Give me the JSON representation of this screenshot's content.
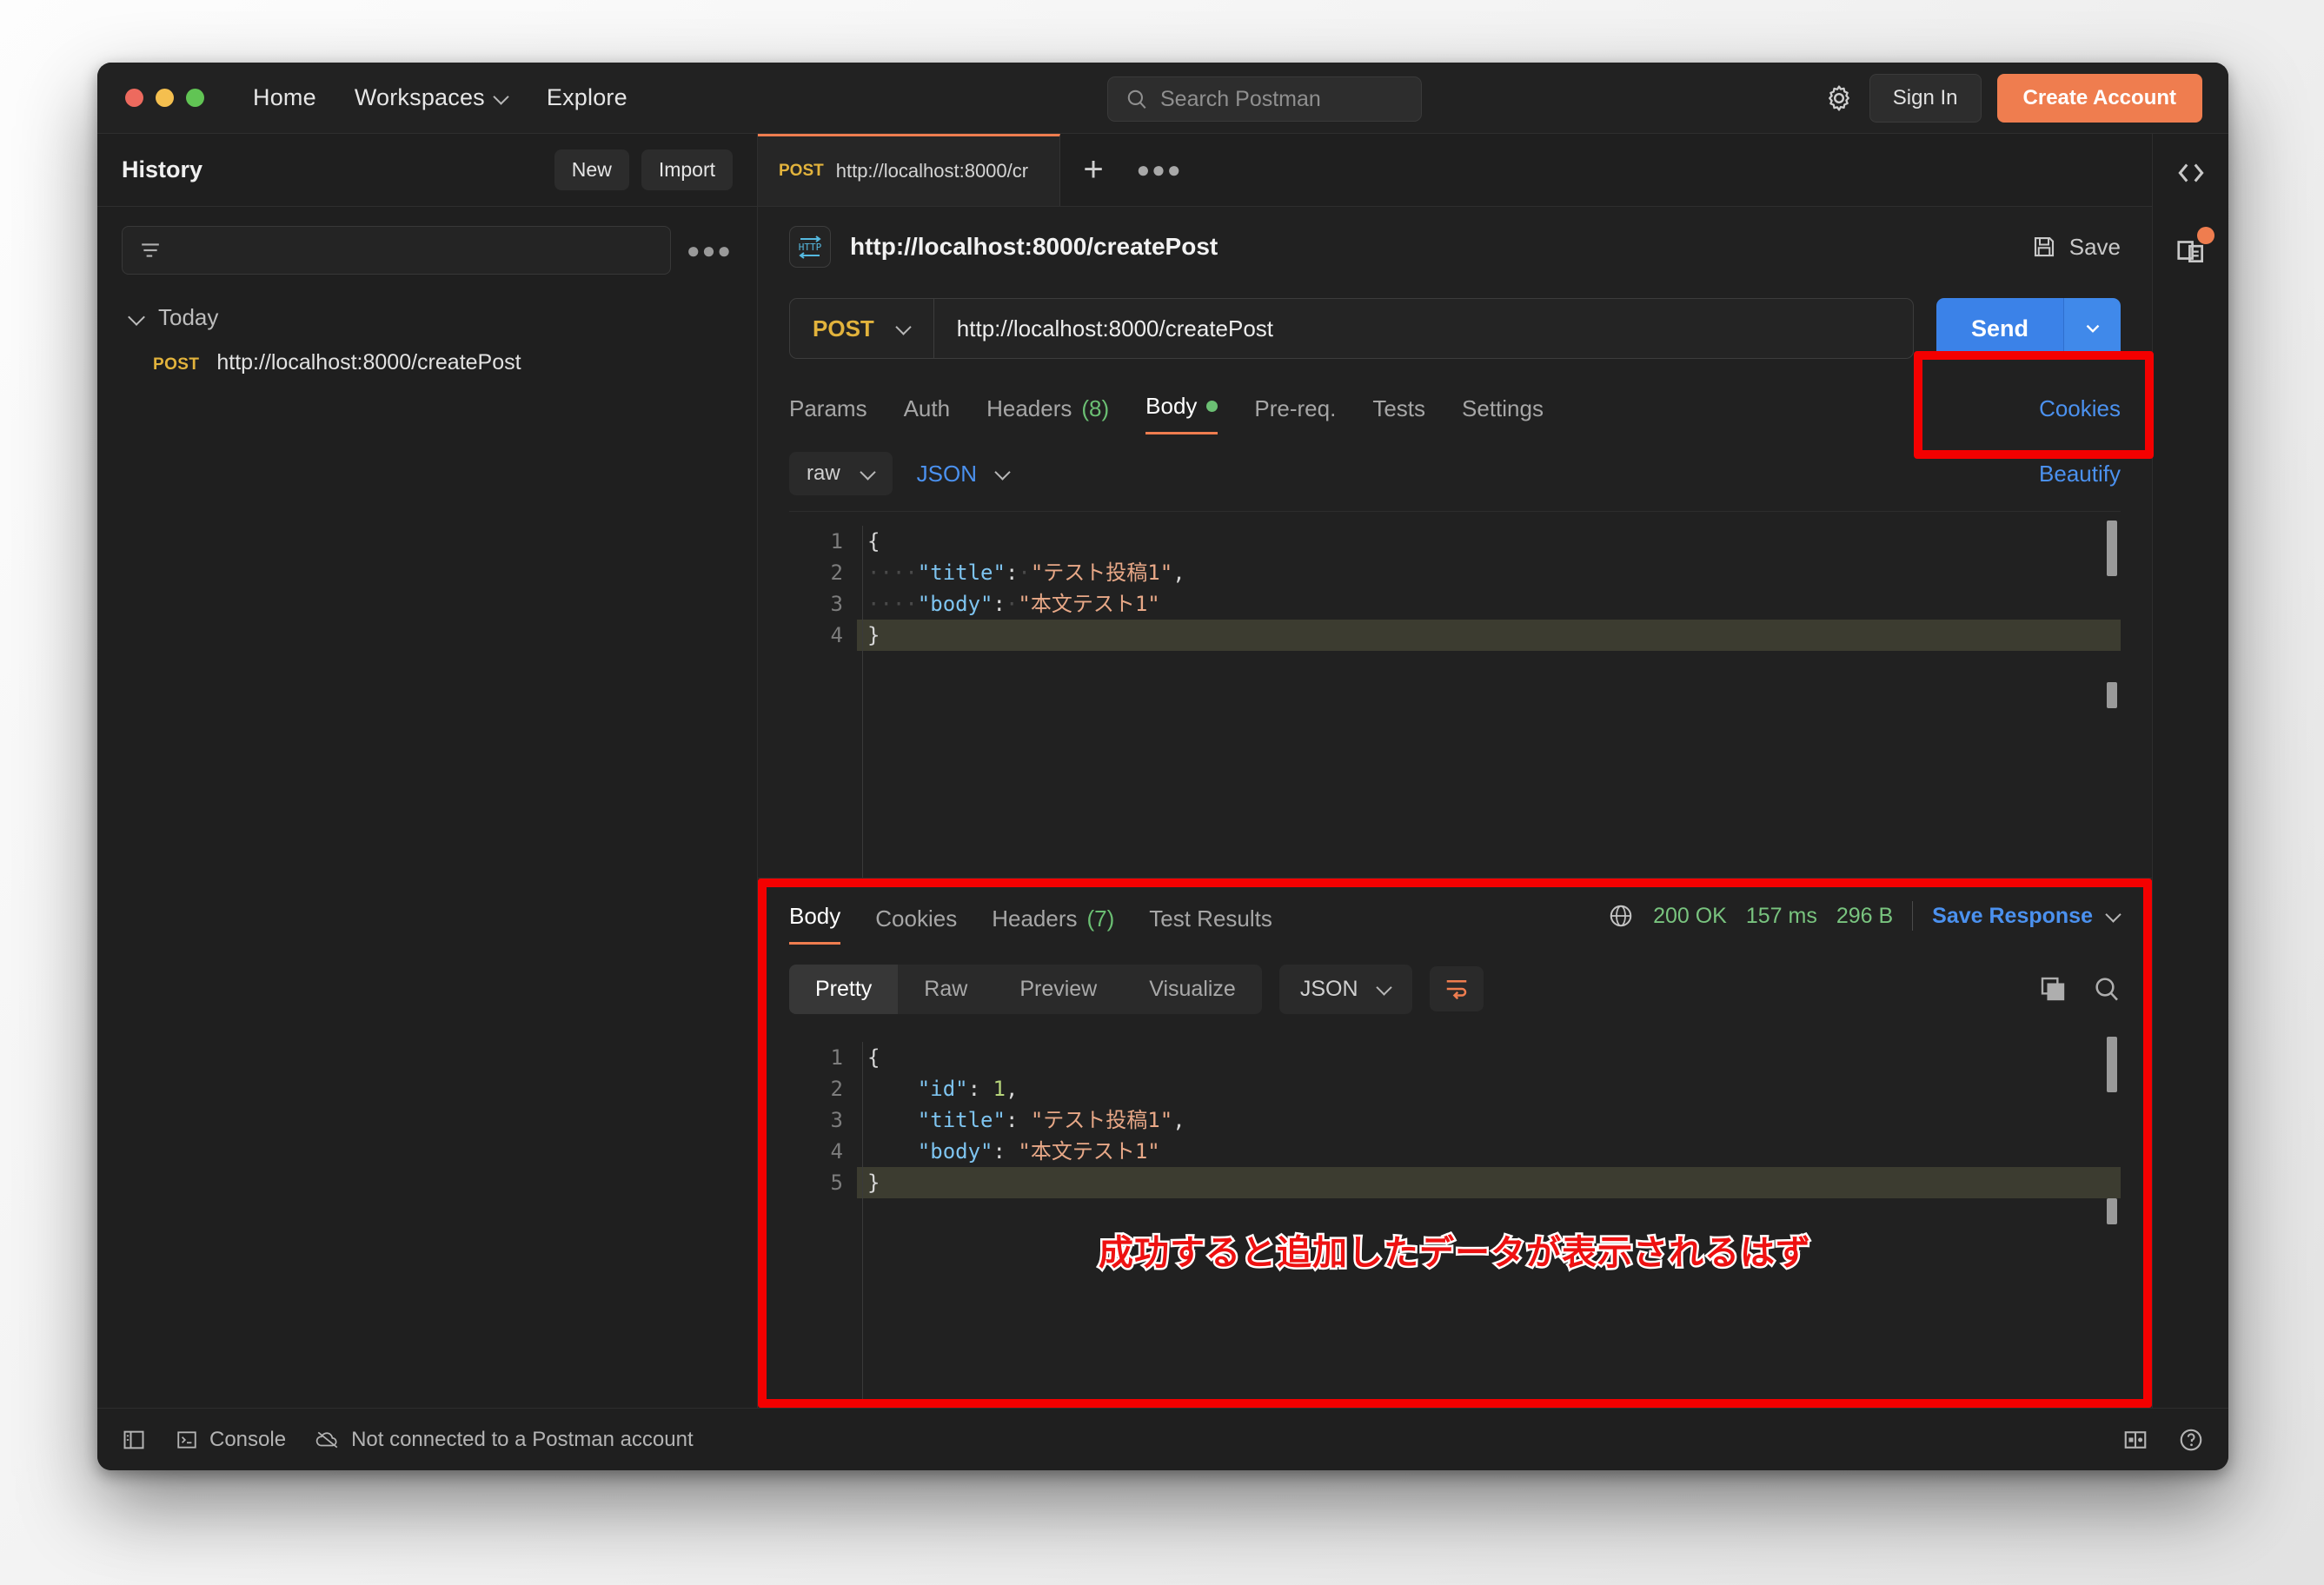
{
  "app": {
    "topnav": [
      {
        "label": "Home",
        "icon": null
      },
      {
        "label": "Workspaces",
        "icon": "chevron-down-icon"
      },
      {
        "label": "Explore",
        "icon": null
      }
    ],
    "search": {
      "placeholder": "Search Postman",
      "icon": "search-icon"
    },
    "sign_in_label": "Sign In",
    "create_account_label": "Create Account",
    "settings_icon": "gear-icon"
  },
  "sidebar": {
    "title": "History",
    "new_label": "New",
    "import_label": "Import",
    "filter_icon": "filter-icon",
    "more_icon": "more-options-icon",
    "groups": [
      {
        "label": "Today",
        "items": [
          {
            "method": "POST",
            "url": "http://localhost:8000/createPost"
          }
        ]
      }
    ]
  },
  "tabstrip": {
    "tabs": [
      {
        "method": "POST",
        "url": "http://localhost:8000/cr"
      }
    ],
    "new_tab_icon": "plus-icon",
    "more_icon": "more-options-icon"
  },
  "request": {
    "protocol_badge": "HTTP",
    "title": "http://localhost:8000/createPost",
    "save_label": "Save",
    "code_icon": "code-icon",
    "method": "POST",
    "url": "http://localhost:8000/createPost",
    "send_label": "Send",
    "send_caret_icon": "chevron-down-icon",
    "tabs": [
      {
        "label": "Params",
        "active": false,
        "count": null,
        "dot": false
      },
      {
        "label": "Auth",
        "active": false,
        "count": null,
        "dot": false
      },
      {
        "label": "Headers",
        "active": false,
        "count": "(8)",
        "dot": false
      },
      {
        "label": "Body",
        "active": true,
        "count": null,
        "dot": true
      },
      {
        "label": "Pre-req.",
        "active": false,
        "count": null,
        "dot": false
      },
      {
        "label": "Tests",
        "active": false,
        "count": null,
        "dot": false
      },
      {
        "label": "Settings",
        "active": false,
        "count": null,
        "dot": false
      }
    ],
    "cookies_label": "Cookies",
    "body_mode": "raw",
    "body_language": "JSON",
    "beautify_label": "Beautify",
    "body_lines": [
      {
        "n": "1",
        "tokens": [
          {
            "t": "{",
            "c": "p"
          }
        ],
        "highlight": false
      },
      {
        "n": "2",
        "tokens": [
          {
            "t": "····",
            "c": "ind"
          },
          {
            "t": "\"title\"",
            "c": "k"
          },
          {
            "t": ":",
            "c": "p"
          },
          {
            "t": "·",
            "c": "ind"
          },
          {
            "t": "\"テスト投稿1\"",
            "c": "s"
          },
          {
            "t": ",",
            "c": "p"
          }
        ],
        "highlight": false
      },
      {
        "n": "3",
        "tokens": [
          {
            "t": "····",
            "c": "ind"
          },
          {
            "t": "\"body\"",
            "c": "k"
          },
          {
            "t": ":",
            "c": "p"
          },
          {
            "t": "·",
            "c": "ind"
          },
          {
            "t": "\"本文テスト1\"",
            "c": "s"
          }
        ],
        "highlight": false
      },
      {
        "n": "4",
        "tokens": [
          {
            "t": "}",
            "c": "p"
          }
        ],
        "highlight": true
      }
    ]
  },
  "response": {
    "tabs": [
      {
        "label": "Body",
        "active": true,
        "count": null
      },
      {
        "label": "Cookies",
        "active": false,
        "count": null
      },
      {
        "label": "Headers",
        "active": false,
        "count": "(7)"
      },
      {
        "label": "Test Results",
        "active": false,
        "count": null
      }
    ],
    "globe_icon": "globe-icon",
    "status": "200 OK",
    "time": "157 ms",
    "size": "296 B",
    "save_response_label": "Save Response",
    "save_response_caret": "chevron-down-icon",
    "view_modes": [
      {
        "label": "Pretty",
        "active": true
      },
      {
        "label": "Raw",
        "active": false
      },
      {
        "label": "Preview",
        "active": false
      },
      {
        "label": "Visualize",
        "active": false
      }
    ],
    "language": "JSON",
    "wrap_icon": "word-wrap-icon",
    "copy_icon": "copy-icon",
    "search_icon": "search-icon",
    "body_lines": [
      {
        "n": "1",
        "tokens": [
          {
            "t": "{",
            "c": "p"
          }
        ],
        "highlight": false
      },
      {
        "n": "2",
        "tokens": [
          {
            "t": "    ",
            "c": "p"
          },
          {
            "t": "\"id\"",
            "c": "k"
          },
          {
            "t": ": ",
            "c": "p"
          },
          {
            "t": "1",
            "c": "n"
          },
          {
            "t": ",",
            "c": "p"
          }
        ],
        "highlight": false
      },
      {
        "n": "3",
        "tokens": [
          {
            "t": "    ",
            "c": "p"
          },
          {
            "t": "\"title\"",
            "c": "k"
          },
          {
            "t": ": ",
            "c": "p"
          },
          {
            "t": "\"テスト投稿1\"",
            "c": "s"
          },
          {
            "t": ",",
            "c": "p"
          }
        ],
        "highlight": false
      },
      {
        "n": "4",
        "tokens": [
          {
            "t": "    ",
            "c": "p"
          },
          {
            "t": "\"body\"",
            "c": "k"
          },
          {
            "t": ": ",
            "c": "p"
          },
          {
            "t": "\"本文テスト1\"",
            "c": "s"
          }
        ],
        "highlight": false
      },
      {
        "n": "5",
        "tokens": [
          {
            "t": "}",
            "c": "p"
          }
        ],
        "highlight": true
      }
    ],
    "annotation_note": "成功すると追加したデータが表示されるはず"
  },
  "rail": {
    "code_icon": "code-icon",
    "docs_icon": "documentation-icon"
  },
  "statusbar": {
    "sidebar_toggle_icon": "sidebar-toggle-icon",
    "console_label": "Console",
    "console_icon": "terminal-icon",
    "account_status": "Not connected to a Postman account",
    "cloud_icon": "cloud-offline-icon",
    "layout_icon": "layout-icon",
    "help_icon": "help-icon"
  },
  "colors": {
    "accent_orange": "#ef7d4f",
    "send_blue": "#3b82e8",
    "link_blue": "#4b91ef",
    "success_green": "#79c47f",
    "method_yellow": "#e2b33c",
    "annotation_red": "#f40000"
  }
}
